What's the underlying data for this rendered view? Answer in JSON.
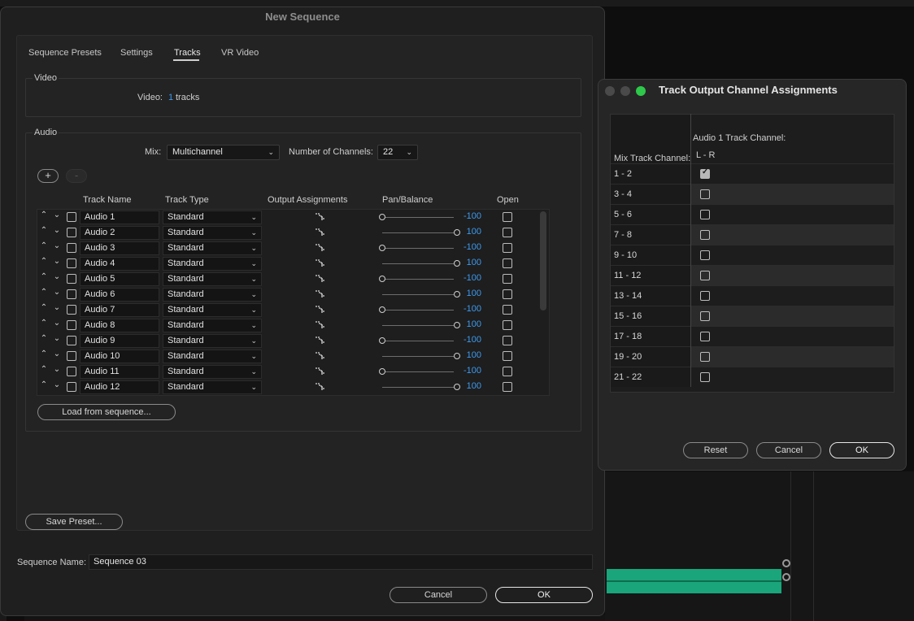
{
  "new_sequence": {
    "title": "New Sequence",
    "tabs": [
      "Sequence Presets",
      "Settings",
      "Tracks",
      "VR Video"
    ],
    "video": {
      "group_label": "Video",
      "label": "Video:",
      "count": "1",
      "suffix": "tracks"
    },
    "audio": {
      "group_label": "Audio",
      "mix_label": "Mix:",
      "mix_value": "Multichannel",
      "channels_label": "Number of Channels:",
      "channels_value": "22",
      "add_symbol": "+",
      "remove_symbol": "-",
      "columns": [
        "Track Name",
        "Track Type",
        "Output Assignments",
        "Pan/Balance",
        "Open"
      ],
      "tracks": [
        {
          "name": "Audio 1",
          "type": "Standard",
          "pan": "-100"
        },
        {
          "name": "Audio 2",
          "type": "Standard",
          "pan": "100"
        },
        {
          "name": "Audio 3",
          "type": "Standard",
          "pan": "-100"
        },
        {
          "name": "Audio 4",
          "type": "Standard",
          "pan": "100"
        },
        {
          "name": "Audio 5",
          "type": "Standard",
          "pan": "-100"
        },
        {
          "name": "Audio 6",
          "type": "Standard",
          "pan": "100"
        },
        {
          "name": "Audio 7",
          "type": "Standard",
          "pan": "-100"
        },
        {
          "name": "Audio 8",
          "type": "Standard",
          "pan": "100"
        },
        {
          "name": "Audio 9",
          "type": "Standard",
          "pan": "-100"
        },
        {
          "name": "Audio 10",
          "type": "Standard",
          "pan": "100"
        },
        {
          "name": "Audio 11",
          "type": "Standard",
          "pan": "-100"
        },
        {
          "name": "Audio 12",
          "type": "Standard",
          "pan": "100"
        }
      ],
      "load_button": "Load from sequence..."
    },
    "save_preset_button": "Save Preset...",
    "sequence_name_label": "Sequence Name:",
    "sequence_name_value": "Sequence 03",
    "cancel_button": "Cancel",
    "ok_button": "OK"
  },
  "track_output": {
    "title": "Track Output Channel Assignments",
    "header_track": "Audio 1 Track Channel:",
    "header_lr": "L - R",
    "header_mix": "Mix Track Channel:",
    "rows": [
      {
        "label": "1 - 2",
        "checked": true
      },
      {
        "label": "3 - 4",
        "checked": false
      },
      {
        "label": "5 - 6",
        "checked": false
      },
      {
        "label": "7 - 8",
        "checked": false
      },
      {
        "label": "9 - 10",
        "checked": false
      },
      {
        "label": "11 - 12",
        "checked": false
      },
      {
        "label": "13 - 14",
        "checked": false
      },
      {
        "label": "15 - 16",
        "checked": false
      },
      {
        "label": "17 - 18",
        "checked": false
      },
      {
        "label": "19 - 20",
        "checked": false
      },
      {
        "label": "21 - 22",
        "checked": false
      }
    ],
    "reset_button": "Reset",
    "cancel_button": "Cancel",
    "ok_button": "OK"
  }
}
